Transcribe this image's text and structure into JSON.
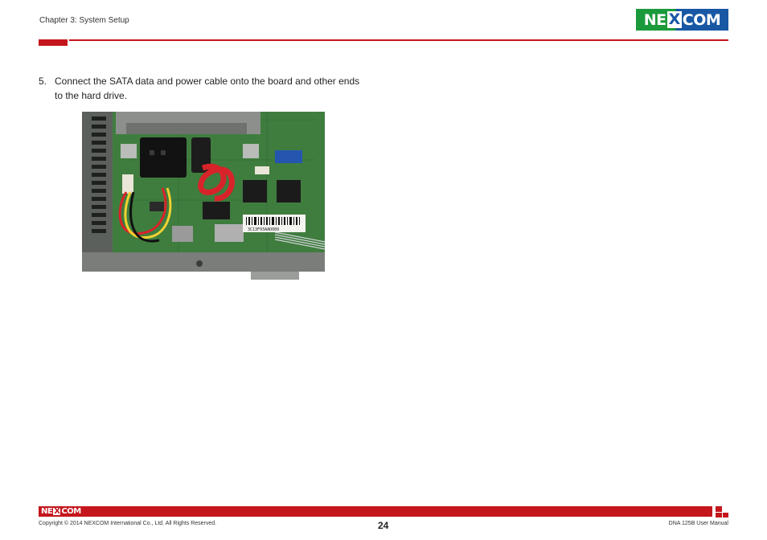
{
  "header": {
    "chapter": "Chapter 3: System Setup",
    "logo": {
      "prefix": "NE",
      "mid": "X",
      "suffix": "COM"
    }
  },
  "content": {
    "step_number": "5.",
    "step_text_line1": "Connect the SATA data and power cable onto the board and other ends",
    "step_text_line2": "to the hard drive."
  },
  "footer": {
    "logo": {
      "prefix": "NE",
      "mid": "X",
      "suffix": "COM"
    },
    "copyright": "Copyright © 2014 NEXCOM International Co., Ltd. All Rights Reserved.",
    "page_number": "24",
    "manual_name": "DNA 125B User Manual"
  },
  "photo": {
    "label_sticker": "3C13F93AAD089"
  },
  "colors": {
    "brand_red": "#c4161c",
    "brand_green": "#1a9a3a",
    "brand_blue": "#1857a4",
    "pcb_green": "#3f7d3e"
  }
}
